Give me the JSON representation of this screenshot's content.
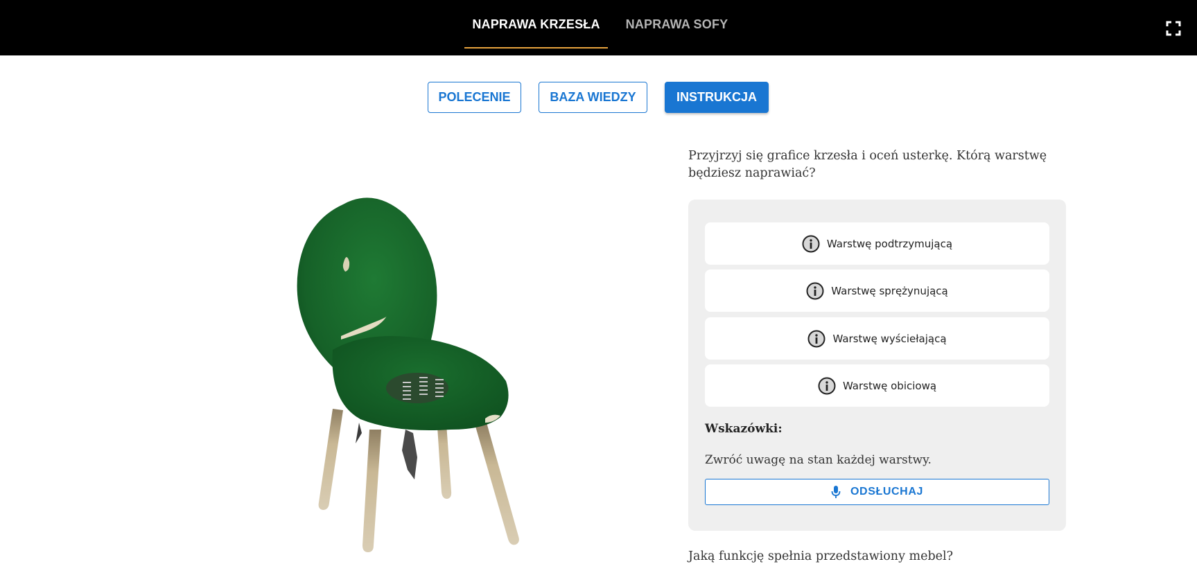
{
  "header": {
    "tabs": [
      {
        "label": "NAPRAWA KRZESŁA",
        "active": true
      },
      {
        "label": "NAPRAWA SOFY",
        "active": false
      }
    ],
    "fullscreen_icon": "fullscreen-icon"
  },
  "modes": {
    "polecenie": "POLECENIE",
    "baza_wiedzy": "BAZA WIEDZY",
    "instrukcja": "INSTRUKCJA",
    "active": "INSTRUKCJA"
  },
  "illustration": {
    "subject": "chair-illustration"
  },
  "question": {
    "text": "Przyjrzyj się grafice krzesła i oceń usterkę. Którą warstwę będziesz naprawiać?"
  },
  "options": [
    {
      "label": "Warstwę podtrzymującą",
      "icon": "info-icon"
    },
    {
      "label": "Warstwę sprężynującą",
      "icon": "info-icon"
    },
    {
      "label": "Warstwę wyściełającą",
      "icon": "info-icon"
    },
    {
      "label": "Warstwę obiciową",
      "icon": "info-icon"
    }
  ],
  "hints": {
    "title": "Wskazówki:",
    "text": "Zwróć uwagę na stan każdej warstwy.",
    "listen_label": "ODSŁUCHAJ",
    "listen_icon": "microphone-icon"
  },
  "question2": {
    "text": "Jaką funkcję spełnia przedstawiony mebel?"
  },
  "colors": {
    "accent": "#1976d2",
    "tab_underline": "#e8a33d",
    "header_bg": "#000000",
    "panel_bg": "#efefef",
    "chair_fabric": "#1b6b2e",
    "chair_legs": "#c8b898"
  }
}
